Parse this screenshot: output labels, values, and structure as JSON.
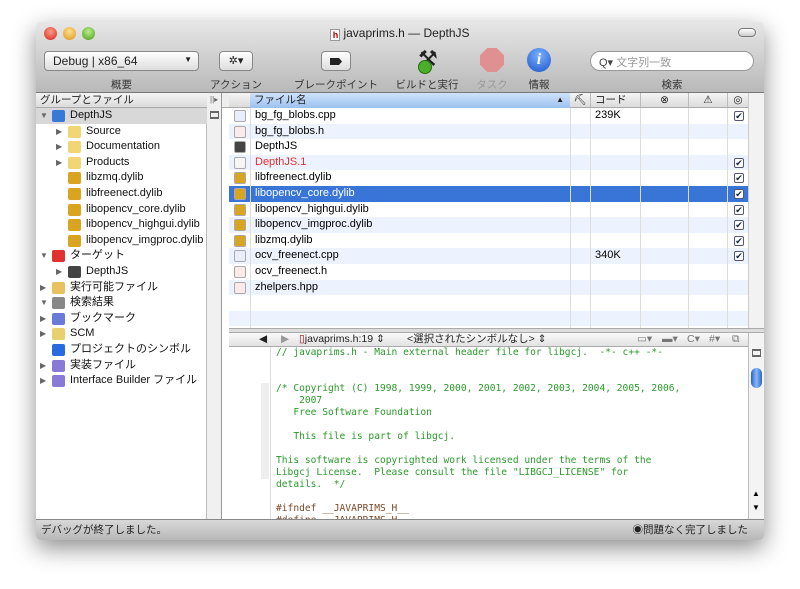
{
  "window": {
    "title": "javaprims.h — DepthJS"
  },
  "toolbar": {
    "scheme": "Debug | x86_64",
    "labels": {
      "overview": "概要",
      "action": "アクション",
      "breakpoints": "ブレークポイント",
      "build_run": "ビルドと実行",
      "tasks": "タスク",
      "info": "情報",
      "search": "検索"
    },
    "search_placeholder": "文字列一致"
  },
  "sidebar": {
    "header": "グループとファイル",
    "items": [
      {
        "label": "DepthJS",
        "indent": 0,
        "tri": "▼",
        "icon": "project-icon",
        "color": "#3a78d8"
      },
      {
        "label": "Source",
        "indent": 1,
        "tri": "▶",
        "icon": "folder-icon",
        "color": "#f2d675"
      },
      {
        "label": "Documentation",
        "indent": 1,
        "tri": "▶",
        "icon": "folder-icon",
        "color": "#f2d675"
      },
      {
        "label": "Products",
        "indent": 1,
        "tri": "▶",
        "icon": "folder-icon",
        "color": "#f2d675"
      },
      {
        "label": "libzmq.dylib",
        "indent": 1,
        "tri": "",
        "icon": "library-icon",
        "color": "#d9a520"
      },
      {
        "label": "libfreenect.dylib",
        "indent": 1,
        "tri": "",
        "icon": "library-icon",
        "color": "#d9a520"
      },
      {
        "label": "libopencv_core.dylib",
        "indent": 1,
        "tri": "",
        "icon": "library-icon",
        "color": "#d9a520"
      },
      {
        "label": "libopencv_highgui.dylib",
        "indent": 1,
        "tri": "",
        "icon": "library-icon",
        "color": "#d9a520"
      },
      {
        "label": "libopencv_imgproc.dylib",
        "indent": 1,
        "tri": "",
        "icon": "library-icon",
        "color": "#d9a520"
      },
      {
        "label": "ターゲット",
        "indent": 0,
        "tri": "▼",
        "icon": "target-icon",
        "color": "#e03030"
      },
      {
        "label": "DepthJS",
        "indent": 1,
        "tri": "▶",
        "icon": "app-target-icon",
        "color": "#444"
      },
      {
        "label": "実行可能ファイル",
        "indent": 0,
        "tri": "▶",
        "icon": "executable-icon",
        "color": "#e8c060"
      },
      {
        "label": "検索結果",
        "indent": 0,
        "tri": "▼",
        "icon": "magnifier-icon",
        "color": "#888"
      },
      {
        "label": "ブックマーク",
        "indent": 0,
        "tri": "▶",
        "icon": "bookmark-icon",
        "color": "#6a7ad8"
      },
      {
        "label": "SCM",
        "indent": 0,
        "tri": "▶",
        "icon": "scm-icon",
        "color": "#e8d070"
      },
      {
        "label": "プロジェクトのシンボル",
        "indent": 0,
        "tri": "",
        "icon": "symbols-icon",
        "color": "#2a6ae0"
      },
      {
        "label": "実装ファイル",
        "indent": 0,
        "tri": "▶",
        "icon": "smart-group-icon",
        "color": "#8a7ad8"
      },
      {
        "label": "Interface Builder ファイル",
        "indent": 0,
        "tri": "▶",
        "icon": "smart-group-icon",
        "color": "#8a7ad8"
      }
    ]
  },
  "file_list": {
    "columns": {
      "name": "ファイル名",
      "build": "⛏",
      "code": "コード",
      "errors": "⊗",
      "warnings": "⚠",
      "target": "◎"
    },
    "rows": [
      {
        "name": "bg_fg_blobs.cpp",
        "code": "239K",
        "checked": true,
        "icon": "cpp-file-icon"
      },
      {
        "name": "bg_fg_blobs.h",
        "code": "",
        "checked": false,
        "icon": "header-file-icon"
      },
      {
        "name": "DepthJS",
        "code": "",
        "checked": false,
        "icon": "executable-icon"
      },
      {
        "name": "DepthJS.1",
        "code": "",
        "checked": true,
        "icon": "document-icon",
        "missing": true
      },
      {
        "name": "libfreenect.dylib",
        "code": "",
        "checked": true,
        "icon": "library-icon"
      },
      {
        "name": "libopencv_core.dylib",
        "code": "",
        "checked": true,
        "icon": "library-icon",
        "selected": true
      },
      {
        "name": "libopencv_highgui.dylib",
        "code": "",
        "checked": true,
        "icon": "library-icon"
      },
      {
        "name": "libopencv_imgproc.dylib",
        "code": "",
        "checked": true,
        "icon": "library-icon"
      },
      {
        "name": "libzmq.dylib",
        "code": "",
        "checked": true,
        "icon": "library-icon"
      },
      {
        "name": "ocv_freenect.cpp",
        "code": "340K",
        "checked": true,
        "icon": "cpp-file-icon"
      },
      {
        "name": "ocv_freenect.h",
        "code": "",
        "checked": false,
        "icon": "header-file-icon"
      },
      {
        "name": "zhelpers.hpp",
        "code": "",
        "checked": false,
        "icon": "header-file-icon"
      }
    ]
  },
  "editor": {
    "file_popup": "javaprims.h:19",
    "symbol_popup": "<選択されたシンボルなし>",
    "lines": [
      {
        "t": "// javaprims.h - Main external header file for libgcj.  -*- c++ -*-",
        "c": "comment"
      },
      {
        "t": "",
        "c": "comment"
      },
      {
        "t": "",
        "c": "comment"
      },
      {
        "t": "/* Copyright (C) 1998, 1999, 2000, 2001, 2002, 2003, 2004, 2005, 2006,",
        "c": "comment"
      },
      {
        "t": "    2007",
        "c": "comment"
      },
      {
        "t": "   Free Software Foundation",
        "c": "comment"
      },
      {
        "t": "",
        "c": "comment"
      },
      {
        "t": "   This file is part of libgcj.",
        "c": "comment"
      },
      {
        "t": "",
        "c": "comment"
      },
      {
        "t": "This software is copyrighted work licensed under the terms of the",
        "c": "comment"
      },
      {
        "t": "Libgcj License.  Please consult the file \"LIBGCJ_LICENSE\" for",
        "c": "comment"
      },
      {
        "t": "details.  */",
        "c": "comment"
      },
      {
        "t": "",
        "c": "comment"
      },
      {
        "t": "#ifndef __JAVAPRIMS_H__",
        "c": "pp"
      },
      {
        "t": "#define __JAVAPRIMS_H__",
        "c": "pp"
      }
    ]
  },
  "status": {
    "left": "デバッグが終了しました。",
    "right": "問題なく完了しました"
  }
}
